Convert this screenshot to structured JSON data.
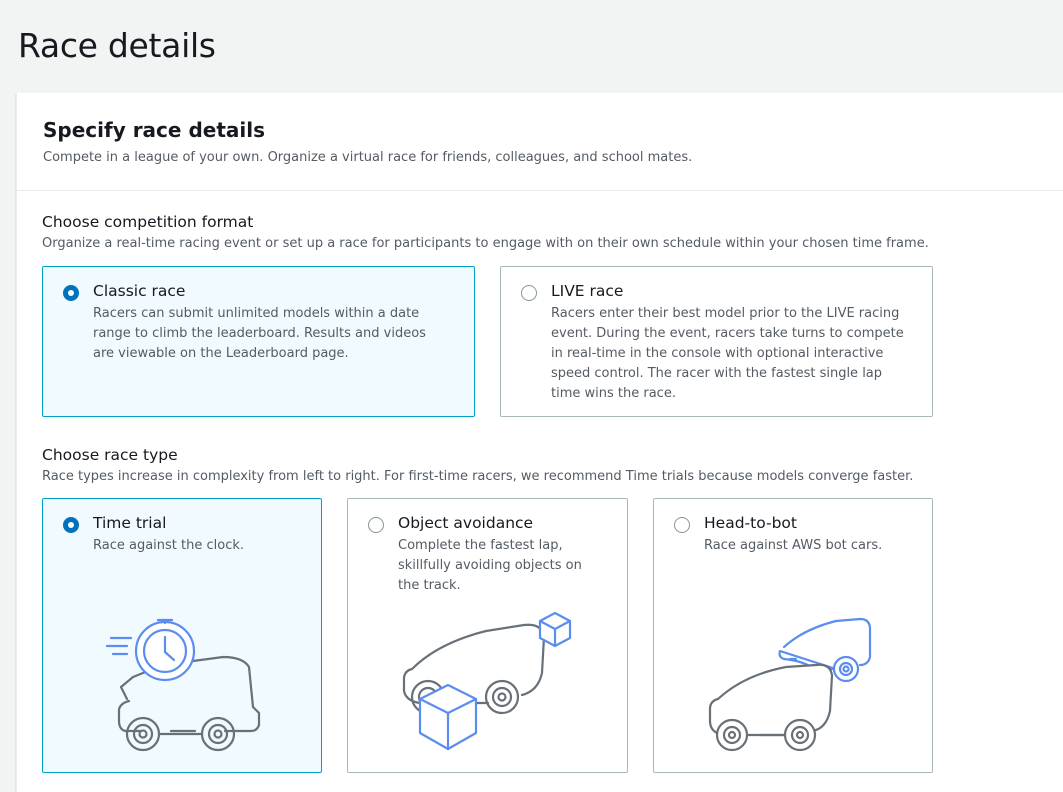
{
  "page": {
    "title": "Race details"
  },
  "container": {
    "title": "Specify race details",
    "description": "Compete in a league of your own. Organize a virtual race for friends, colleagues, and school mates."
  },
  "competition_format": {
    "label": "Choose competition format",
    "description": "Organize a real-time racing event or set up a race for participants to engage with on their own schedule within your chosen time frame.",
    "selected": "classic",
    "options": [
      {
        "id": "classic",
        "title": "Classic race",
        "desc_lines": [
          "Racers can submit unlimited models within a date",
          "range to climb the leaderboard. Results and videos",
          "are viewable on the Leaderboard page."
        ]
      },
      {
        "id": "live",
        "title": "LIVE race",
        "desc_lines": [
          "Racers enter their best model prior to the LIVE racing",
          "event. During the event, racers take turns to compete",
          "in real-time in the console with optional interactive",
          "speed control. The racer with the fastest single lap",
          "time wins the race."
        ]
      }
    ]
  },
  "race_type": {
    "label": "Choose race type",
    "description": "Race types increase in complexity from left to right. For first-time racers, we recommend Time trials because models converge faster.",
    "selected": "time_trial",
    "options": [
      {
        "id": "time_trial",
        "title": "Time trial",
        "desc_lines": [
          "Race against the clock."
        ],
        "icon": "stopwatch-car-icon"
      },
      {
        "id": "object_avoidance",
        "title": "Object avoidance",
        "desc_lines": [
          "Complete the fastest lap,",
          "skillfully avoiding objects on",
          "the track."
        ],
        "icon": "car-with-boxes-icon"
      },
      {
        "id": "head_to_bot",
        "title": "Head-to-bot",
        "desc_lines": [
          "Race against AWS bot cars."
        ],
        "icon": "two-cars-icon"
      }
    ]
  },
  "colors": {
    "accent": "#0073bb",
    "selected_border": "#00a1c9",
    "selected_bg": "#f1faff",
    "illustration_blue": "#5b8def",
    "illustration_gray": "#687078"
  }
}
